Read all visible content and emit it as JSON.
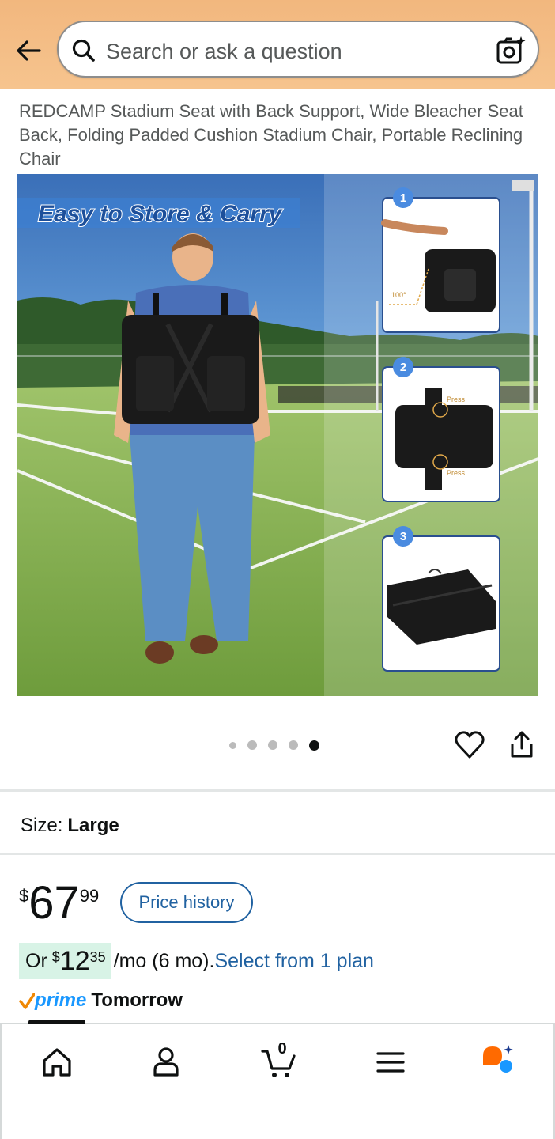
{
  "header": {
    "search_placeholder": "Search or ask a question"
  },
  "product": {
    "title": "REDCAMP Stadium Seat with Back Support, Wide Bleacher Seat Back, Folding Padded Cushion Stadium Chair, Portable Reclining Chair",
    "image": {
      "banner_text": "Easy to Store & Carry",
      "step_numbers": [
        "1",
        "2",
        "3"
      ],
      "angle_label": "100°",
      "press_label": "Press"
    },
    "carousel": {
      "total": 5,
      "active_index": 4
    }
  },
  "size": {
    "label": "Size:",
    "value": "Large"
  },
  "price": {
    "currency": "$",
    "whole": "67",
    "fraction": "99",
    "history_button": "Price history"
  },
  "monthly": {
    "prefix": "Or",
    "currency": "$",
    "whole": "12",
    "fraction": "35",
    "suffix": "/mo (6 mo).",
    "link": "Select from 1 plan"
  },
  "delivery": {
    "prime": "prime",
    "day": "Tomorrow"
  },
  "nav": {
    "cart_count": "0",
    "items": [
      "home-icon",
      "account-icon",
      "cart-icon",
      "menu-icon",
      "rufus-icon"
    ]
  },
  "colors": {
    "header": "#f6c48e",
    "link": "#2162a1",
    "prime_blue": "#1a98ff",
    "prime_check": "#f08804",
    "monthly_highlight": "#d8f3e6",
    "rufus_orange": "#ff6a00",
    "rufus_blue": "#1a98ff"
  }
}
